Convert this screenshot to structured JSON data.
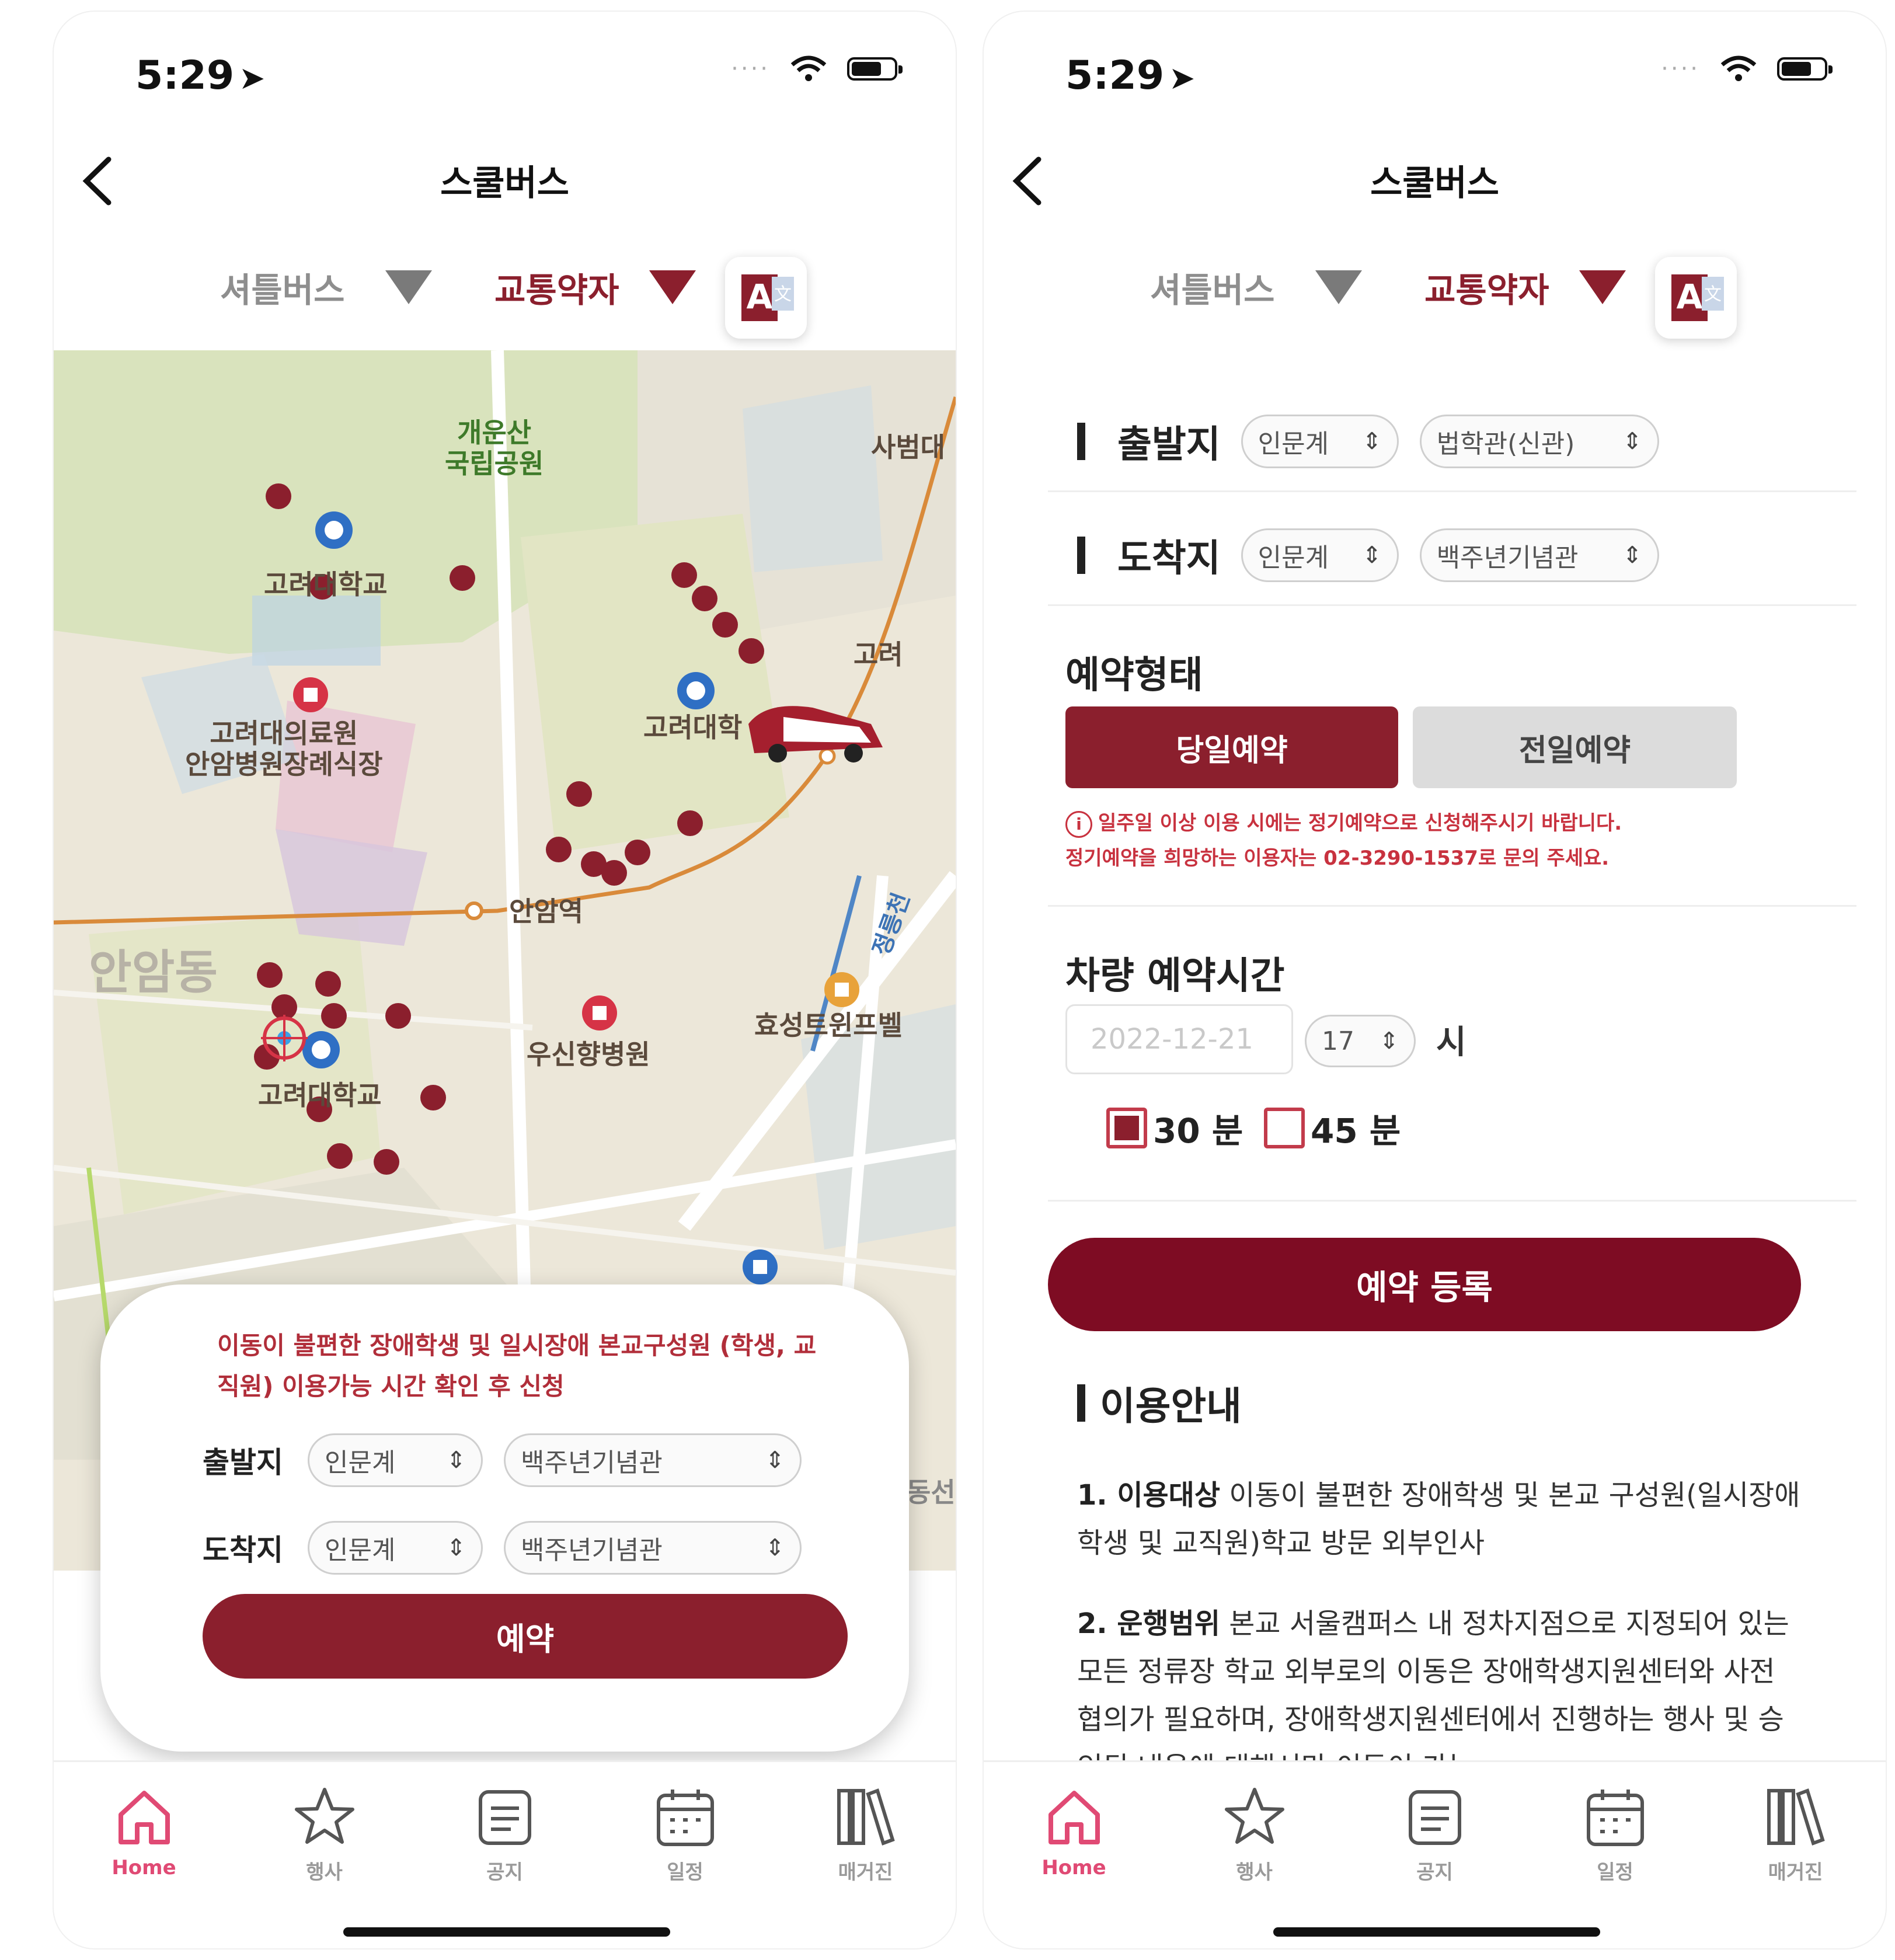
{
  "status": {
    "time": "5:29"
  },
  "header": {
    "title": "스쿨버스"
  },
  "mode_tabs": {
    "shuttle": "셔틀버스",
    "disabled": "교통약자"
  },
  "map": {
    "labels": {
      "park": "개운산\n국립공원",
      "sabeom": "사범대",
      "korea_univ_top": "고려대학교",
      "korea_univ_right": "고려대학",
      "hospital": "고려대의료원\n안암병원장례식장",
      "station": "안암역",
      "goryeo_edge": "고려",
      "jeongneungcheon": "정릉천",
      "hospital_woosin": "우신향병원",
      "hyosung": "효성트윈프벨",
      "korea_univ_bottom": "고려대학교",
      "dong_left": "안암동",
      "dong_right": "동선"
    }
  },
  "sheet": {
    "notice": "이동이 불편한 장애학생 및 일시장애 본교구성원 (학생, 교직원) 이용가능 시간 확인 후 신청",
    "departure_label": "출발지",
    "departure_campus": "인문계",
    "departure_building": "백주년기념관",
    "arrival_label": "도착지",
    "arrival_campus": "인문계",
    "arrival_building": "백주년기념관",
    "reserve": "예약"
  },
  "form": {
    "departure_label": "출발지",
    "departure_campus": "인문계",
    "departure_building": "법학관(신관)",
    "arrival_label": "도착지",
    "arrival_campus": "인문계",
    "arrival_building": "백주년기념관",
    "reservation_type_title": "예약형태",
    "type_today": "당일예약",
    "type_prev": "전일예약",
    "notice_line1": "일주일 이상 이용 시에는 정기예약으로 신청해주시기 바랍니다.",
    "notice_line2": "정기예약을 희망하는 이용자는 02-3290-1537로 문의 주세요.",
    "time_title": "차량 예약시간",
    "date_placeholder": "2022-12-21",
    "hour": "17",
    "hour_unit": "시",
    "min30": "30 분",
    "min45": "45 분",
    "submit": "예약 등록",
    "guide_title": "이용안내",
    "guide1_head": "1. 이용대상",
    "guide1_body": " 이동이 불편한 장애학생 및 본교 구성원(일시장애 학생 및 교직원)학교 방문 외부인사",
    "guide2_head": "2. 운행범위",
    "guide2_body": " 본교 서울캠퍼스 내 정차지점으로 지정되어 있는 모든 정류장   학교 외부로의 이동은 장애학생지원센터와 사전 협의가 필요하며, 장애학생지원센터에서 진행하는 행사 및 승인된 내용에 대해서만 이동이 가능"
  },
  "nav": {
    "items": [
      {
        "label": "Home",
        "icon": "home-icon"
      },
      {
        "label": "행사",
        "icon": "star-icon"
      },
      {
        "label": "공지",
        "icon": "notice-icon"
      },
      {
        "label": "일정",
        "icon": "calendar-icon"
      },
      {
        "label": "매거진",
        "icon": "magazine-icon"
      }
    ]
  },
  "colors": {
    "accent": "#8b1f2d",
    "submit": "#7e0c23",
    "active_nav": "#e04a74"
  }
}
